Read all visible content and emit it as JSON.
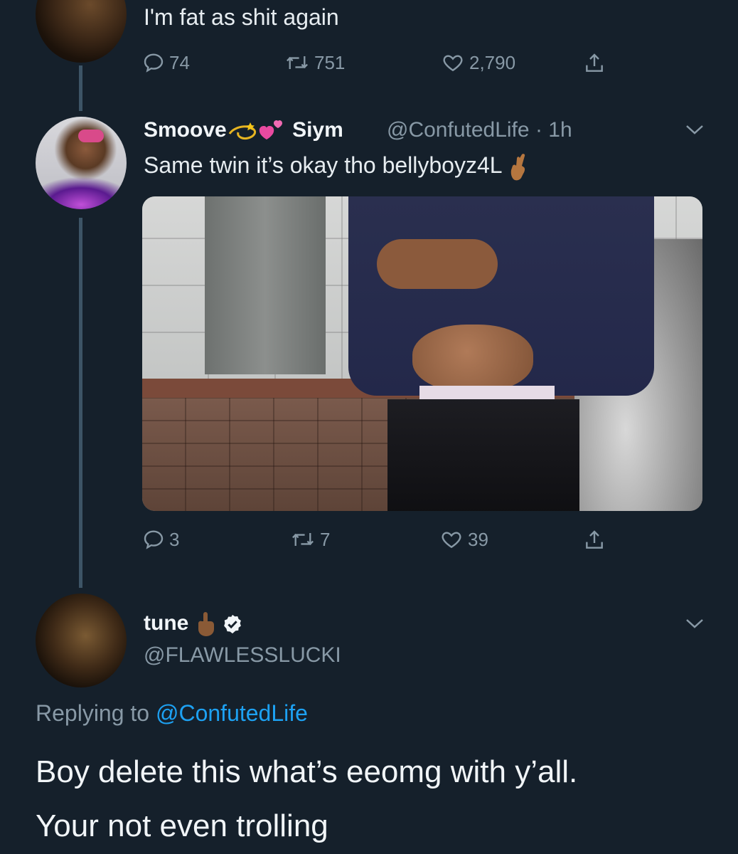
{
  "top_tweet": {
    "text": "I'm fat as shit again",
    "actions": {
      "replies": "74",
      "retweets": "751",
      "likes": "2,790"
    }
  },
  "reply_tweet": {
    "display_name_part1": "Smoove",
    "display_name_part2": "Siym",
    "handle": "@ConfutedLife",
    "separator": "·",
    "time": "1h",
    "text": "Same twin it’s okay tho bellyboyz4L",
    "actions": {
      "replies": "3",
      "retweets": "7",
      "likes": "39"
    }
  },
  "main_tweet": {
    "display_name": "tune",
    "handle": "@FLAWLESSLUCKI",
    "replying_prefix": "Replying to",
    "replying_to": "@ConfutedLife",
    "text_line1": "Boy delete this what’s eeomg with y’all.",
    "text_line2": "Your not even trolling"
  },
  "icons": {
    "reply": "reply-icon",
    "retweet": "retweet-icon",
    "like": "heart-icon",
    "share": "share-icon",
    "more": "chevron-down-icon",
    "verified": "verified-badge-icon"
  },
  "colors": {
    "background": "#15202b",
    "text": "#e1e8ed",
    "muted": "#8899a6",
    "accent": "#1da1f2"
  }
}
